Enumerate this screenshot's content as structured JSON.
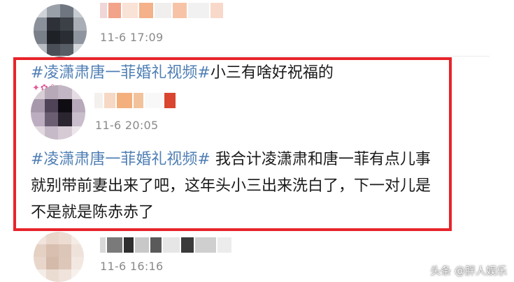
{
  "comments": [
    {
      "time": "11-6 17:09"
    },
    {
      "time": "11-6 20:05",
      "post_hashtag": "#凌潇肃唐一菲婚礼视频#",
      "post_text": "小三有啥好祝福的",
      "reply_hashtag": "#凌潇肃唐一菲婚礼视频#",
      "reply_text": " 我合计凌潇肃和唐一菲有点儿事就别带前妻出来了吧，这年头小三出来洗白了，下一对儿是不是就是陈赤赤了"
    },
    {
      "time": "11-6 16:16"
    }
  ],
  "watermark": "头条 @胖人娱乐",
  "colors": {
    "highlight_border": "#e8242b",
    "hashtag": "#4f7fb5",
    "timestamp": "#8a8a8a",
    "text": "#1a1a1a"
  }
}
